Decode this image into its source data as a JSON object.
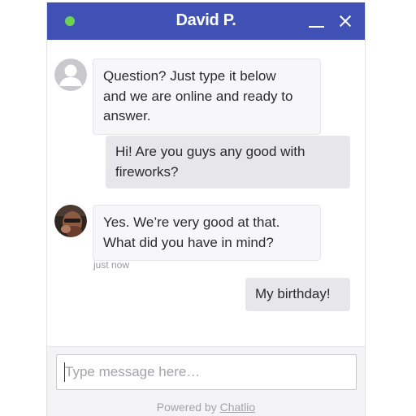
{
  "header": {
    "agent_name": "David P.",
    "online_status_color": "#6fd154",
    "background_color": "#3f51b5",
    "minimize_icon": "minimize-icon",
    "close_icon": "close-icon"
  },
  "messages": [
    {
      "sender": "agent",
      "avatar": "default-user-icon",
      "lines": [
        "Question? Just type it below",
        "and we are online and ready to",
        "answer."
      ]
    },
    {
      "sender": "visitor",
      "lines": [
        "Hi! Are you guys any good with",
        "fireworks?"
      ]
    },
    {
      "sender": "agent",
      "avatar": "agent-photo",
      "lines": [
        "Yes. We’re very good at that.",
        "What did you have in mind?"
      ],
      "timestamp": "just now"
    },
    {
      "sender": "visitor",
      "lines": [
        "My birthday!"
      ]
    }
  ],
  "composer": {
    "placeholder": "Type message here…",
    "value": ""
  },
  "footer": {
    "powered_prefix": "Powered by ",
    "brand_link": "Chatlio"
  }
}
